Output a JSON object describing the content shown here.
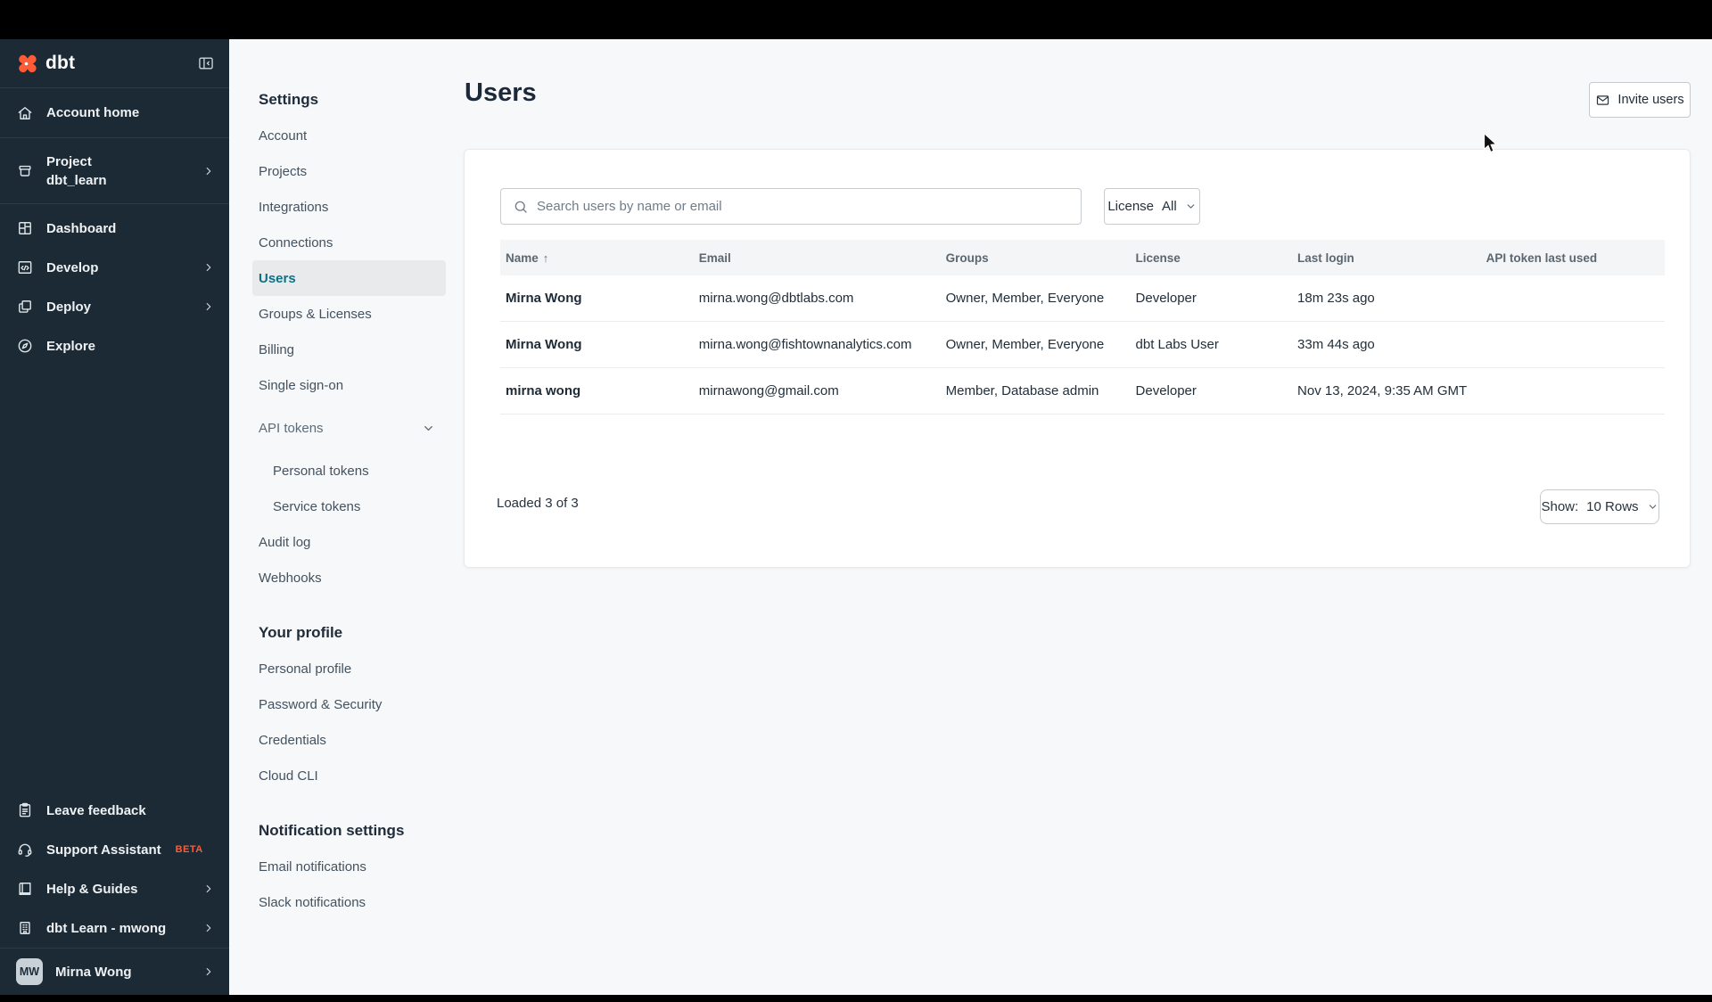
{
  "app": {
    "logo_text": "dbt"
  },
  "colors": {
    "accent_orange": "#ff5c35",
    "accent_teal": "#0c7285",
    "sidebar_bg": "#1c2a35"
  },
  "sidebar": {
    "items": [
      {
        "label": "Account home",
        "icon": "home"
      },
      {
        "label": "Project",
        "sublabel": "dbt_learn",
        "icon": "project-box"
      },
      {
        "label": "Dashboard",
        "icon": "dashboard-grid"
      },
      {
        "label": "Develop",
        "icon": "code-window"
      },
      {
        "label": "Deploy",
        "icon": "stacked-squares"
      },
      {
        "label": "Explore",
        "icon": "compass"
      }
    ],
    "footer_items": [
      {
        "label": "Leave feedback",
        "icon": "clipboard"
      },
      {
        "label": "Support Assistant",
        "badge": "BETA",
        "icon": "headset"
      },
      {
        "label": "Help & Guides",
        "icon": "book"
      },
      {
        "label": "dbt Learn - mwong",
        "icon": "building"
      }
    ],
    "user": {
      "initials": "MW",
      "name": "Mirna Wong"
    }
  },
  "settings_nav": {
    "title": "Settings",
    "items": [
      "Account",
      "Projects",
      "Integrations",
      "Connections",
      "Users",
      "Groups & Licenses",
      "Billing",
      "Single sign-on"
    ],
    "selected": "Users",
    "api_tokens": {
      "label": "API tokens",
      "children": [
        "Personal tokens",
        "Service tokens"
      ]
    },
    "items_after": [
      "Audit log",
      "Webhooks"
    ],
    "profile": {
      "title": "Your profile",
      "items": [
        "Personal profile",
        "Password & Security",
        "Credentials",
        "Cloud CLI"
      ]
    },
    "notifications": {
      "title": "Notification settings",
      "items": [
        "Email notifications",
        "Slack notifications"
      ]
    }
  },
  "header": {
    "title": "Users",
    "invite_button": "Invite users"
  },
  "toolbar": {
    "search_placeholder": "Search users by name or email",
    "license_label": "License",
    "license_value": "All"
  },
  "users_table": {
    "columns": [
      "Name",
      "Email",
      "Groups",
      "License",
      "Last login",
      "API token last used"
    ],
    "sort_arrow": "↑",
    "rows": [
      {
        "name": "Mirna Wong",
        "email": "mirna.wong@dbtlabs.com",
        "groups": "Owner, Member, Everyone",
        "license": "Developer",
        "last_login": "18m 23s ago",
        "api_token_last_used": ""
      },
      {
        "name": "Mirna Wong",
        "email": "mirna.wong@fishtownanalytics.com",
        "groups": "Owner, Member, Everyone",
        "license": "dbt Labs User",
        "last_login": "33m 44s ago",
        "api_token_last_used": ""
      },
      {
        "name": "mirna wong",
        "email": "mirnawong@gmail.com",
        "groups": "Member, Database admin",
        "license": "Developer",
        "last_login": "Nov 13, 2024, 9:35 AM GMT",
        "api_token_last_used": ""
      }
    ],
    "footer": {
      "loaded_text": "Loaded 3 of 3",
      "show_label": "Show:",
      "show_value": "10 Rows"
    }
  }
}
